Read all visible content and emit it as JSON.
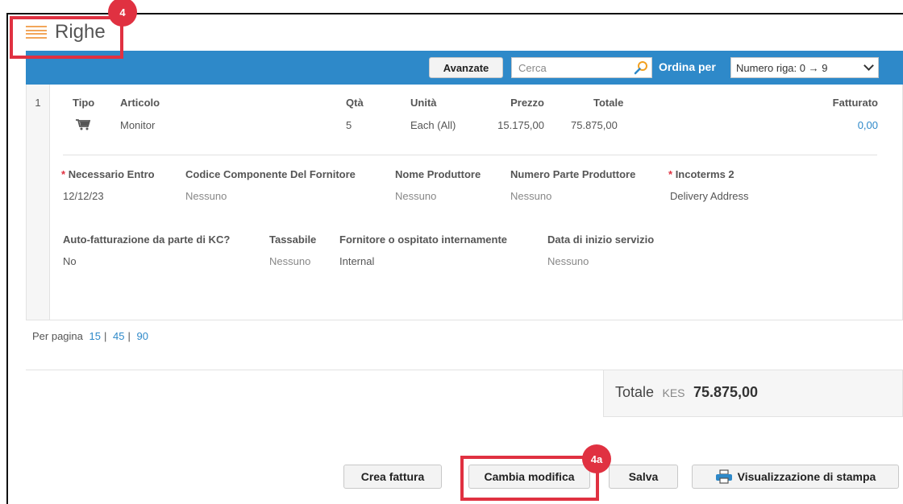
{
  "section": {
    "title": "Righe"
  },
  "badges": {
    "title_step": "4",
    "action_step": "4a"
  },
  "toolbar": {
    "advanced_label": "Avanzate",
    "search_placeholder": "Cerca",
    "sort_label": "Ordina per",
    "sort_value": "Numero riga: 0 → 9"
  },
  "line": {
    "number": "1",
    "headers": {
      "type": "Tipo",
      "item": "Articolo",
      "qty": "Qtà",
      "unit": "Unità",
      "price": "Prezzo",
      "total": "Totale",
      "invoiced": "Fatturato"
    },
    "values": {
      "type_icon": "cart-icon",
      "item": "Monitor",
      "qty": "5",
      "unit": "Each (All)",
      "price": "15.175,00",
      "total": "75.875,00",
      "invoiced": "0,00"
    },
    "details_row1": [
      {
        "label": "Necessario Entro",
        "required": true,
        "value": "12/12/23"
      },
      {
        "label": "Codice Componente Del Fornitore",
        "required": false,
        "value": "Nessuno"
      },
      {
        "label": "Nome Produttore",
        "required": false,
        "value": "Nessuno"
      },
      {
        "label": "Numero Parte Produttore",
        "required": false,
        "value": "Nessuno"
      },
      {
        "label": "Incoterms 2",
        "required": true,
        "value": "Delivery Address"
      }
    ],
    "details_row2": [
      {
        "label": "Auto-fatturazione da parte di KC?",
        "value": "No"
      },
      {
        "label": "Tassabile",
        "value": "Nessuno"
      },
      {
        "label": "Fornitore o ospitato internamente",
        "value": "Internal"
      },
      {
        "label": "Data di inizio servizio",
        "value": "Nessuno"
      }
    ]
  },
  "pagination": {
    "label": "Per pagina",
    "options": [
      "15",
      "45",
      "90"
    ],
    "separator": "|"
  },
  "totals": {
    "label": "Totale",
    "currency": "KES",
    "value": "75.875,00"
  },
  "actions": {
    "create_invoice": "Crea fattura",
    "change_order": "Cambia modifica",
    "save": "Salva",
    "print_preview": "Visualizzazione di stampa"
  },
  "colors": {
    "toolbar": "#2e89c9",
    "link": "#2e89c9",
    "highlight": "#e03141",
    "required": "#e03141"
  }
}
